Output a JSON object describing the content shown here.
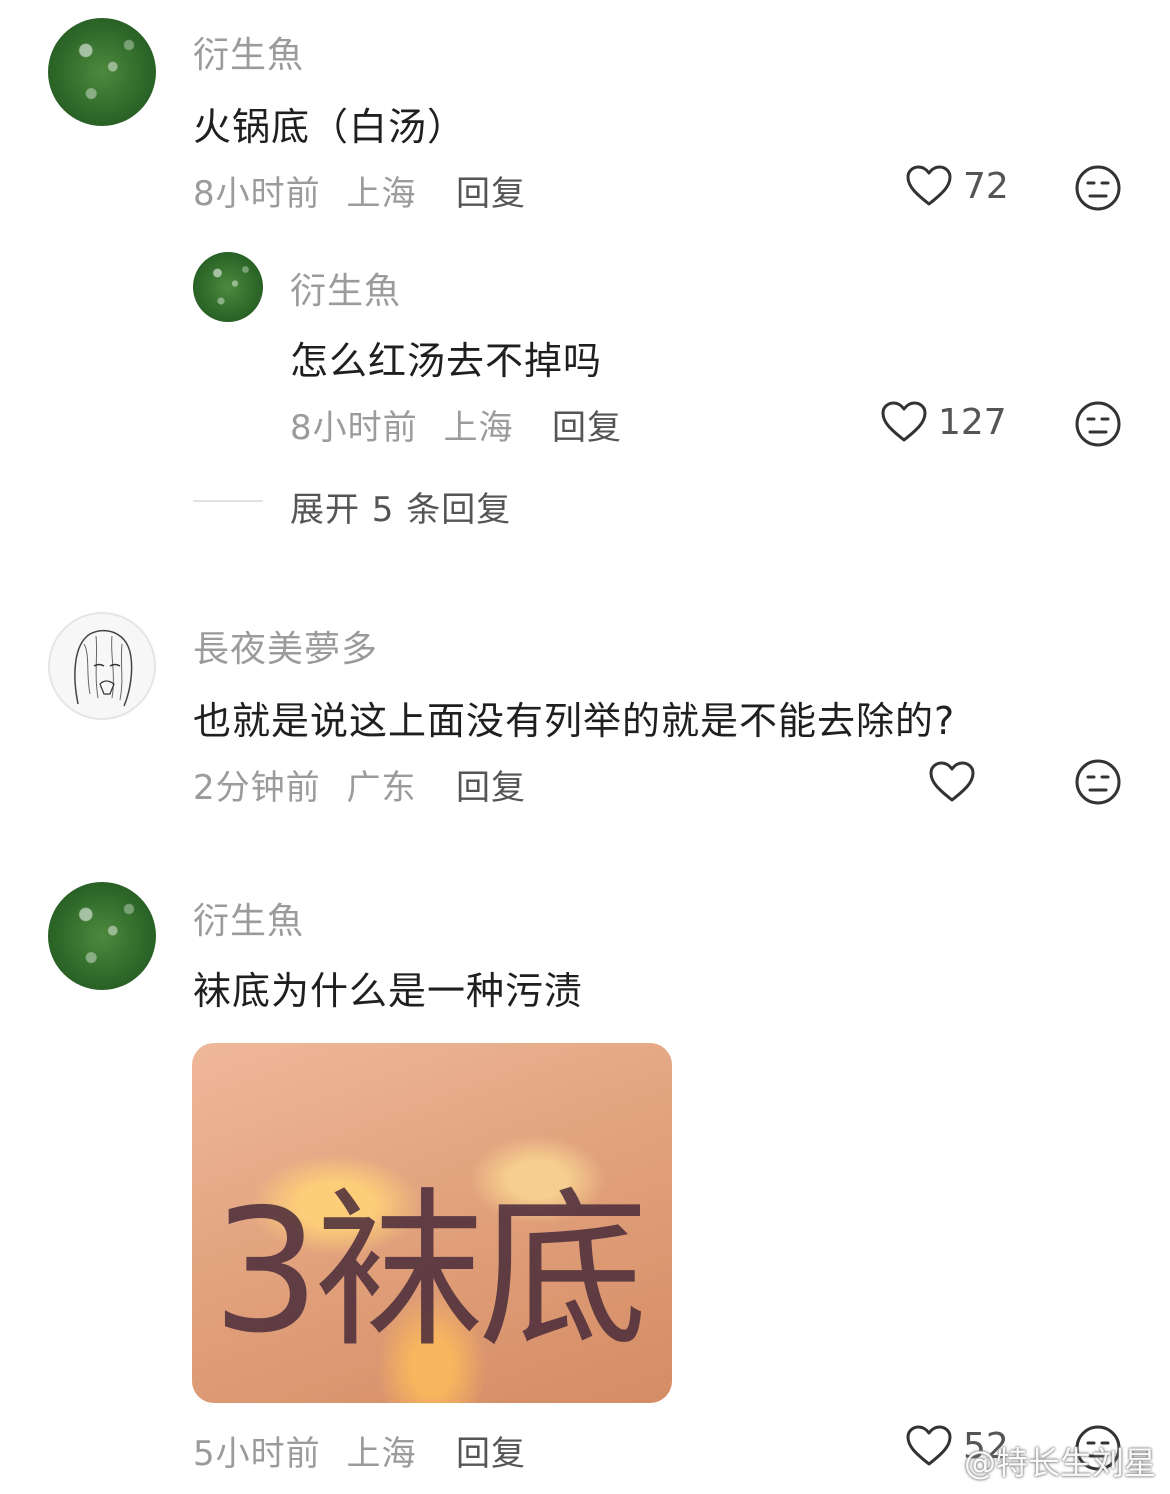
{
  "comments": [
    {
      "user": "衍生魚",
      "text": "火锅底（白汤）",
      "time": "8小时前",
      "location": "上海",
      "reply_label": "回复",
      "likes": "72",
      "replies": [
        {
          "user": "衍生魚",
          "text": "怎么红汤去不掉吗",
          "time": "8小时前",
          "location": "上海",
          "reply_label": "回复",
          "likes": "127"
        }
      ],
      "expand_label": "展开 5 条回复"
    },
    {
      "user": "長夜美夢多",
      "text": "也就是说这上面没有列举的就是不能去除的?",
      "time": "2分钟前",
      "location": "广东",
      "reply_label": "回复",
      "likes": ""
    },
    {
      "user": "衍生魚",
      "text": "袜底为什么是一种污渍",
      "image_text": "3袜底",
      "time": "5小时前",
      "location": "上海",
      "reply_label": "回复",
      "likes": "52"
    }
  ],
  "watermark": "@特长生刘星"
}
